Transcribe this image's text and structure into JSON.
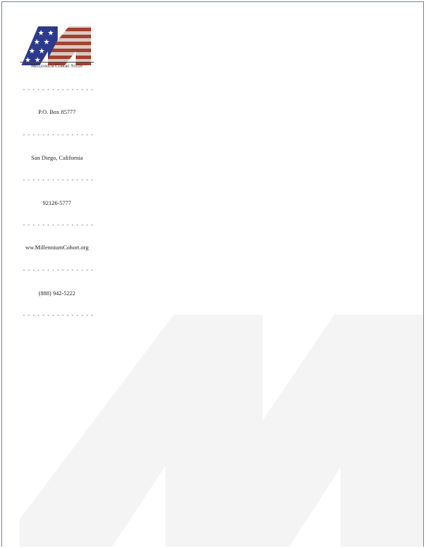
{
  "organization": {
    "logo_text": "Millennium Cohort Study"
  },
  "contact": {
    "po_box": "P.O. Box 85777",
    "city_state": "San Diego, California",
    "zip": "92126-5777",
    "website": "ww.MillenniumCohort.org",
    "phone": "(888) 942-5222"
  },
  "colors": {
    "frame_border": "#5b86b0",
    "watermark": "#f4f4f4",
    "flag_blue": "#2d3a8c",
    "flag_red": "#a3402f",
    "flag_stripe_light": "#d9c9c3"
  },
  "icons": {
    "logo": "mcs-flag-m-logo",
    "watermark": "large-m-watermark"
  }
}
